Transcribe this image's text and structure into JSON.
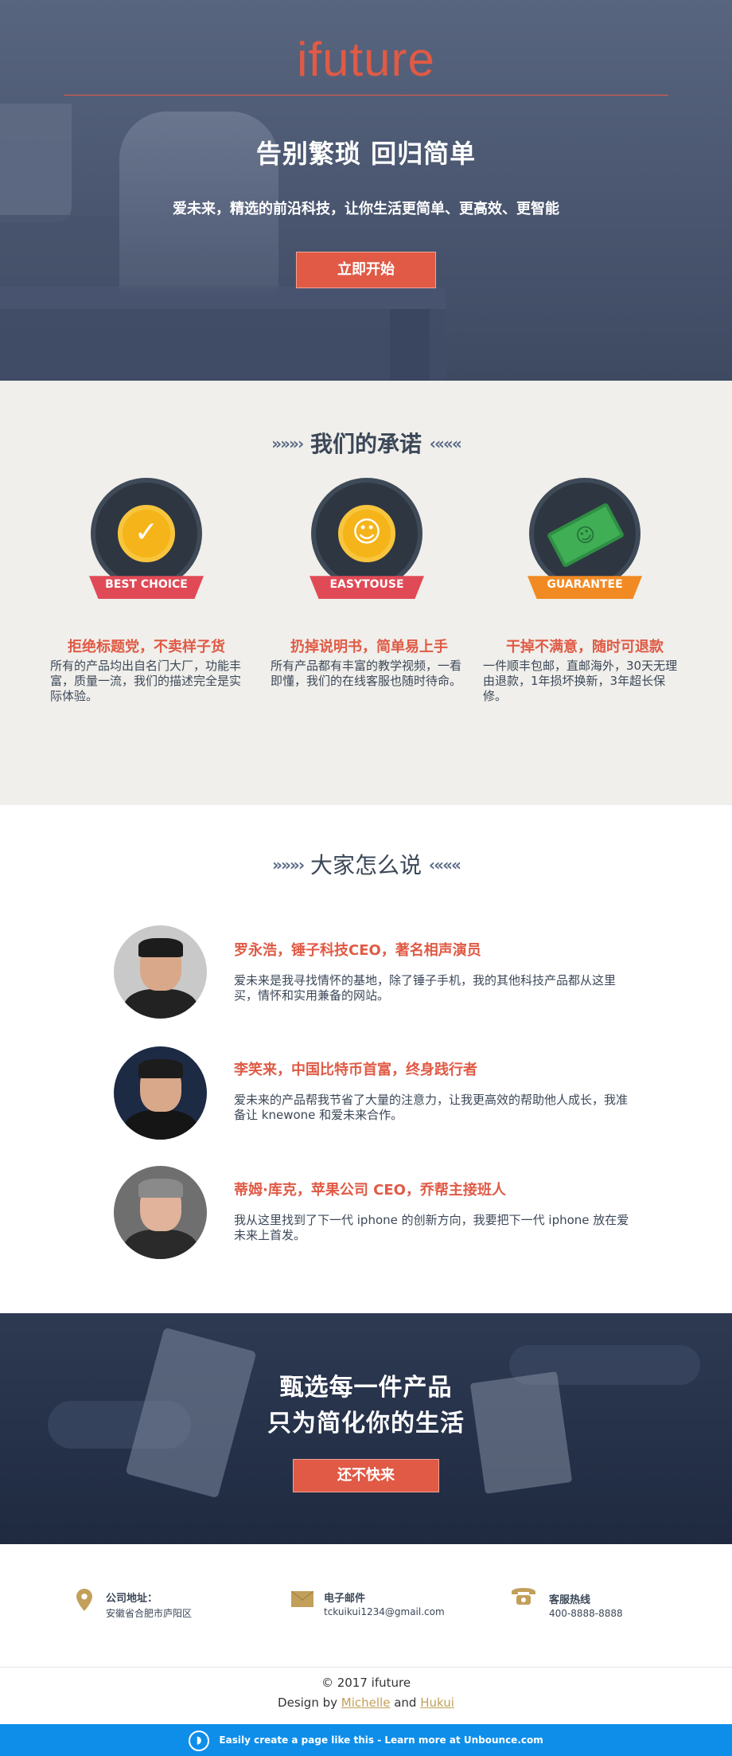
{
  "hero": {
    "brand": "ifuture",
    "title": "告别繁琐  回归简单",
    "subtitle": "爱未来，精选的前沿科技，让你生活更简单、更高效、更智能",
    "cta": "立即开始"
  },
  "promise": {
    "arrows_left": "»»»›",
    "arrows_right": "‹«««",
    "heading": "我们的承诺",
    "items": [
      {
        "badge": "BEST CHOICE",
        "title": "拒绝标题党，不卖样子货",
        "text": "所有的产品均出自名门大厂，功能丰富，质量一流，我们的描述完全是实际体验。"
      },
      {
        "badge": "EASYTOUSE",
        "title": "扔掉说明书，简单易上手",
        "text": "所有产品都有丰富的教学视频，一看即懂，我们的在线客服也随时待命。"
      },
      {
        "badge": "GUARANTEE",
        "title": "干掉不满意，随时可退款",
        "text": "一件顺丰包邮，直邮海外，30天无理由退款，1年损坏换新，3年超长保修。"
      }
    ]
  },
  "testimonials": {
    "heading": "大家怎么说",
    "items": [
      {
        "name": "罗永浩，锤子科技CEO，著名相声演员",
        "text": "爱未来是我寻找情怀的基地，除了锤子手机，我的其他科技产品都从这里买，情怀和实用兼备的网站。"
      },
      {
        "name": "李笑来，中国比特币首富，终身践行者",
        "text": "爱未来的产品帮我节省了大量的注意力，让我更高效的帮助他人成长，我准备让 knewone 和爱未来合作。"
      },
      {
        "name": "蒂姆·库克，苹果公司 CEO，乔帮主接班人",
        "text": "我从这里找到了下一代 iphone 的创新方向，我要把下一代 iphone 放在爱未来上首发。"
      }
    ]
  },
  "banner": {
    "line1": "甄选每一件产品",
    "line2": "只为简化你的生活",
    "cta": "还不快来"
  },
  "contact": {
    "address_label": "公司地址：",
    "address_value": "安徽省合肥市庐阳区",
    "email_label": "电子邮件",
    "email_value": "tckuikui1234@gmail.com",
    "phone_label": "客服热线",
    "phone_value": "400-8888-8888"
  },
  "footer": {
    "copyright": "© 2017 ifuture",
    "design_by": "Design by",
    "author1": "Michelle",
    "and": "and",
    "author2": "Hukui",
    "unbounce": "Easily create a page like this - Learn more at Unbounce.com"
  },
  "colors": {
    "accent": "#e05a45",
    "dark": "#3c4858",
    "gold": "#c2a05a",
    "unbounce_blue": "#0e8ee9",
    "promise_bg": "#f0efeb"
  },
  "icons": [
    "check-icon",
    "smiley-icon",
    "cash-icon",
    "map-pin-icon",
    "email-icon",
    "phone-icon",
    "unbounce-logo-icon"
  ]
}
